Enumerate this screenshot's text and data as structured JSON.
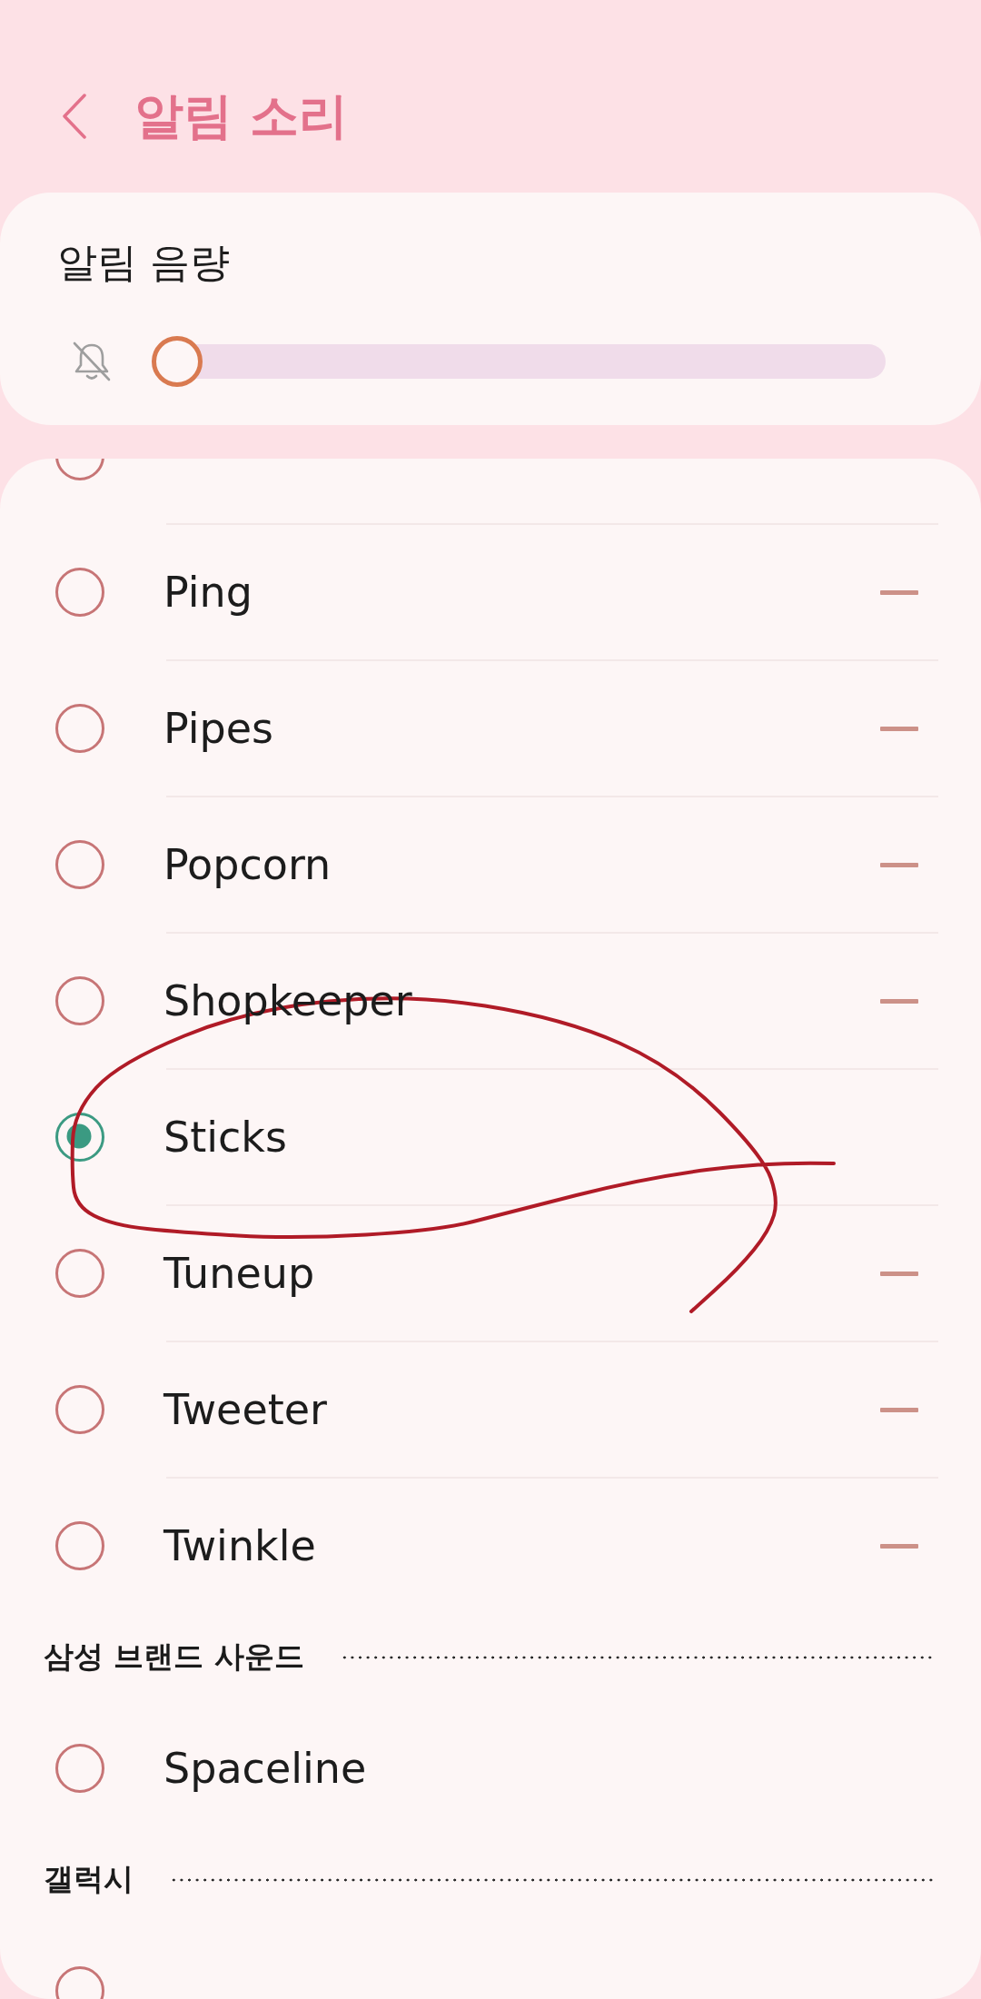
{
  "header": {
    "title": "알림 소리"
  },
  "volume": {
    "label": "알림 음량",
    "level": 0
  },
  "sounds": [
    {
      "kind": "sound",
      "selected": false,
      "minus": false
    },
    {
      "kind": "sound",
      "name": "Ping",
      "selected": false,
      "minus": true
    },
    {
      "kind": "sound",
      "name": "Pipes",
      "selected": false,
      "minus": true
    },
    {
      "kind": "sound",
      "name": "Popcorn",
      "selected": false,
      "minus": true
    },
    {
      "kind": "sound",
      "name": "Shopkeeper",
      "selected": false,
      "minus": true
    },
    {
      "kind": "sound",
      "name": "Sticks",
      "selected": true,
      "minus": false
    },
    {
      "kind": "sound",
      "name": "Tuneup",
      "selected": false,
      "minus": true
    },
    {
      "kind": "sound",
      "name": "Tweeter",
      "selected": false,
      "minus": true
    },
    {
      "kind": "sound",
      "name": "Twinkle",
      "selected": false,
      "minus": true
    },
    {
      "kind": "heading",
      "title": "삼성 브랜드 사운드"
    },
    {
      "kind": "sound",
      "name": "Spaceline",
      "selected": false,
      "minus": false
    },
    {
      "kind": "heading",
      "title": "갤럭시"
    },
    {
      "kind": "sound",
      "selected": false,
      "minus": false
    }
  ]
}
